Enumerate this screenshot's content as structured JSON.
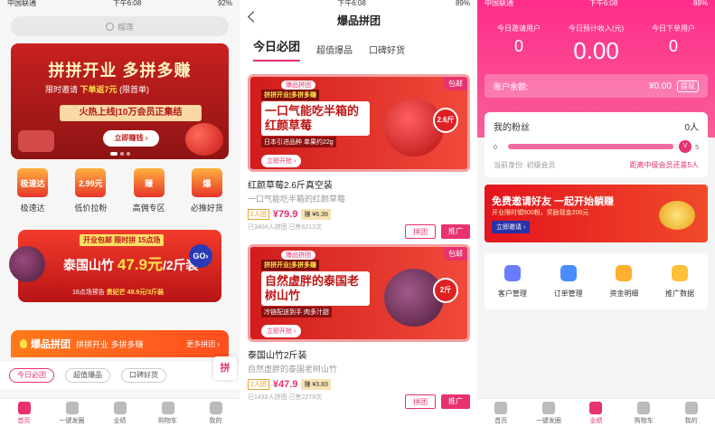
{
  "panel1": {
    "status": {
      "carrier": "中国联通",
      "time": "下午6:08",
      "battery": "92%"
    },
    "search_placeholder": "榴莲",
    "banner": {
      "title": "拼拼开业 多拼多赚",
      "subtitle_prefix": "限时邀请",
      "subtitle_highlight": "下单返7元",
      "subtitle_suffix": "(限首单)",
      "band": "火热上线|10万会员正集结",
      "cta": "立即赚钱 ›"
    },
    "categories": [
      {
        "icon_text": "极速达",
        "label": "极速达",
        "icon": "lightning-delivery-icon"
      },
      {
        "icon_text": "2.99元",
        "label": "低价拉粉",
        "icon": "price-tag-icon"
      },
      {
        "icon_text": "赚",
        "label": "高佣专区",
        "icon": "commission-icon"
      },
      {
        "icon_text": "爆",
        "label": "必推好货",
        "icon": "hot-item-icon"
      }
    ],
    "promo": {
      "top": "开业包邮 限时拼 15点场",
      "main_prefix": "泰国山竹 ",
      "main_price": "47.9元",
      "main_suffix": "/2斤装",
      "go": "GO›",
      "foot_prefix": "18点场预告 ",
      "foot_highlight": "贵妃芒 49.9元/3斤装"
    },
    "hot_section": {
      "title": "爆品拼团",
      "subtitle": "拼拼开业 多拼多赚",
      "more": "更多拼团 ›"
    },
    "pills": [
      {
        "label": "今日必团",
        "active": true
      },
      {
        "label": "超值爆品",
        "active": false
      },
      {
        "label": "口碑好货",
        "active": false
      }
    ],
    "float_button": "拼",
    "tabbar": [
      {
        "label": "首页",
        "icon": "home-icon",
        "active": true
      },
      {
        "label": "一键发圈",
        "icon": "share-icon",
        "active": false
      },
      {
        "label": "业绩",
        "icon": "chart-icon",
        "active": false
      },
      {
        "label": "购物车",
        "icon": "cart-icon",
        "active": false
      },
      {
        "label": "我的",
        "icon": "profile-icon",
        "active": false
      }
    ]
  },
  "panel2": {
    "status": {
      "time": "下午6:08",
      "battery": "89%"
    },
    "title": "爆品拼团",
    "tabs": [
      {
        "label": "今日必团",
        "active": true
      },
      {
        "label": "超值爆品",
        "active": false
      },
      {
        "label": "口碑好货",
        "active": false
      }
    ],
    "products": [
      {
        "tag": "爆品拼团",
        "slogan": "拼拼开业|多拼多赚",
        "headline": "一口气能吃半箱的红颜草莓",
        "note": "日本引进品种 单果约22g",
        "cta": "立即开抢 ›",
        "badge": "包邮",
        "weight": "2.6斤",
        "name": "红颜草莓2.6斤真空装",
        "desc": "一口气能吃半箱的红颜草莓",
        "people": "2人团",
        "price": "¥79.9",
        "earn": "赚 ¥6.39",
        "stat": "已3404人拼团  已售6212次",
        "btn_group": "拼团",
        "btn_promote": "推广"
      },
      {
        "tag": "爆品拼团",
        "slogan": "拼拼开业|多拼多赚",
        "headline": "自然虚胖的泰国老树山竹",
        "note": "冷链配送到手 肉多汁甜",
        "cta": "立即开抢 ›",
        "badge": "包邮",
        "weight": "2斤",
        "name": "泰国山竹2斤装",
        "desc": "自然虚胖的泰国老树山竹",
        "people": "2人团",
        "price": "¥47.9",
        "earn": "赚 ¥3.83",
        "stat": "已1433人拼团  已售2279次",
        "btn_group": "拼团",
        "btn_promote": "推广"
      }
    ]
  },
  "panel3": {
    "status": {
      "carrier": "中国联通",
      "time": "下午6:08",
      "battery": "88%"
    },
    "stats": [
      {
        "label": "今日邀请用户",
        "value": "0"
      },
      {
        "label": "今日预计收入(元)",
        "value": "0.00"
      },
      {
        "label": "今日下单用户",
        "value": "0"
      }
    ],
    "balance": {
      "label": "账户余额:",
      "value": "¥0.00",
      "button": "提现"
    },
    "fans": {
      "label": "我的粉丝",
      "count": "0人",
      "progress_from": "0",
      "progress_to": "5",
      "progress_fraction": 0.92,
      "level_badge": "V",
      "identity": "当前身份: 初级会员",
      "gap": "距离中级会员还差5人"
    },
    "invite": {
      "title": "免费邀请好友 一起开始躺赚",
      "sub": "开业限时領500粉，奖励现金200元",
      "cta": "立即邀请 ›"
    },
    "tools": [
      {
        "label": "客户管理",
        "icon": "customer-icon",
        "color": "#6a7bff"
      },
      {
        "label": "订单管理",
        "icon": "order-icon",
        "color": "#4a8cff"
      },
      {
        "label": "资金明细",
        "icon": "funds-icon",
        "color": "#ffb02e"
      },
      {
        "label": "推广数据",
        "icon": "promo-data-icon",
        "color": "#ffc03a"
      }
    ],
    "tabbar": [
      {
        "label": "首页",
        "icon": "home-icon",
        "active": false
      },
      {
        "label": "一键发圈",
        "icon": "share-icon",
        "active": false
      },
      {
        "label": "业绩",
        "icon": "chart-icon",
        "active": true
      },
      {
        "label": "购物车",
        "icon": "cart-icon",
        "active": false
      },
      {
        "label": "我的",
        "icon": "profile-icon",
        "active": false
      }
    ]
  },
  "colors": {
    "accent": "#e8326e",
    "header_pink": "#ff2d8a",
    "banner_red": "#c8201f"
  }
}
